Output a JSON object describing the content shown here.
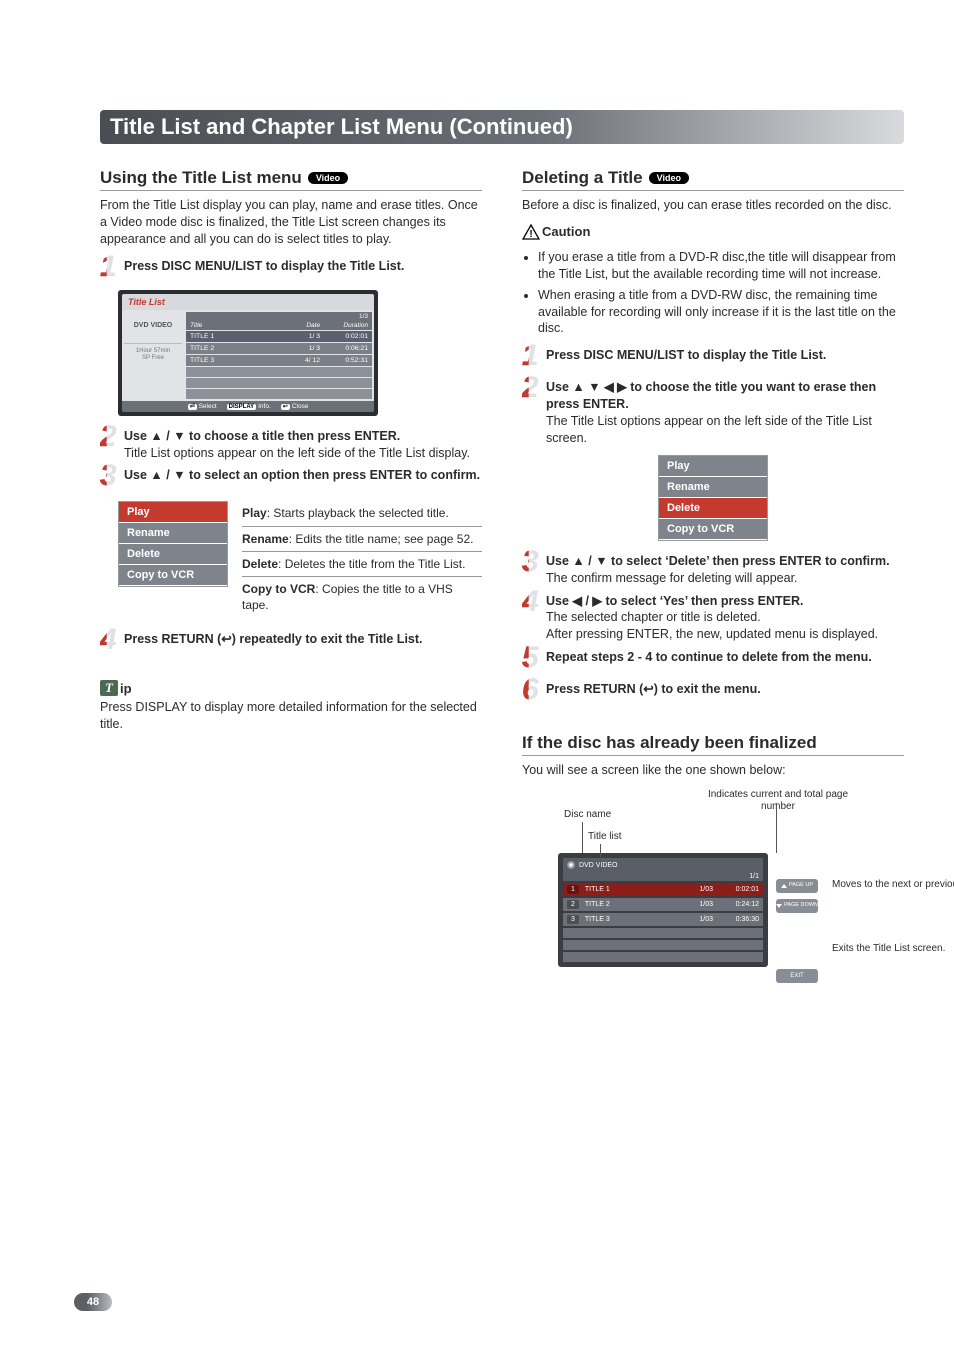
{
  "titlebar": "Title List and Chapter List Menu (Continued)",
  "badge_video": "Video",
  "left": {
    "heading": "Using the Title List menu",
    "intro": "From the Title List display you can play, name and erase titles. Once a Video mode disc is finalized, the Title List screen changes its appearance and all you can do is select titles to play.",
    "step1": "Press DISC MENU/LIST to display the Title List.",
    "step2_a": "Use ▲ / ▼ to choose a title then press ENTER.",
    "step2_b": "Title List options appear on the left side of the Title List display.",
    "step3": "Use ▲ / ▼ to select an option then press ENTER to confirm.",
    "opt_play": "Play",
    "opt_rename": "Rename",
    "opt_delete": "Delete",
    "opt_copy": "Copy to VCR",
    "desc_play": " Starts playback the selected title.",
    "desc_rename": " Edits the title name; see page 52.",
    "desc_delete": " Deletes the title from the Title List.",
    "desc_copy": " Copies the title to a VHS tape.",
    "step4": "Press RETURN (↩) repeatedly to exit the Title List.",
    "tip_label": "ip",
    "tip_text": "Press DISPLAY to display more detailed information for the selected title."
  },
  "title_list": {
    "header": "Title List",
    "page": "1/3",
    "side_label": "DVD VIDEO",
    "side_stat1": "1Hour 57min",
    "side_stat2": "SP Free",
    "col_title": "Title",
    "col_date": "Date",
    "col_duration": "Duration",
    "rows": [
      {
        "t": "TITLE 1",
        "d": "1/ 3",
        "u": "0:02:01"
      },
      {
        "t": "TITLE 2",
        "d": "1/ 3",
        "u": "0:06:21"
      },
      {
        "t": "TITLE 3",
        "d": "4/ 12",
        "u": "0:52:31"
      }
    ],
    "foot_select": "Select",
    "foot_display": "DISPLAY",
    "foot_info": "Info.",
    "foot_close": "Close"
  },
  "right": {
    "heading": "Deleting a Title",
    "intro": "Before a disc is finalized, you can erase titles recorded on the disc.",
    "caution_label": "Caution",
    "caution1": "If you erase a title from a DVD-R disc,the title will disappear from the Title List, but the available recording time will not increase.",
    "caution2": "When erasing a title from a DVD-RW disc, the remaining time available for recording will only increase if it is the last title on the disc.",
    "step1": "Press DISC MENU/LIST to display the Title List.",
    "step2_a": "Use ▲ ▼ ◀ ▶ to choose the title you want to erase then press ENTER.",
    "step2_b": "The Title List options appear on the left side of the Title List screen.",
    "step3_a": "Use ▲ / ▼ to select ‘Delete’ then press ENTER to confirm.",
    "step3_b": "The confirm message for deleting will appear.",
    "step4_a": "Use ◀ / ▶ to select ‘Yes’ then press ENTER.",
    "step4_b": "The selected chapter or title is deleted.",
    "step4_c": "After pressing ENTER, the new, updated menu is displayed.",
    "step5": "Repeat steps 2 - 4 to continue to delete from the menu.",
    "step6": "Press RETURN (↩) to exit the menu.",
    "finalized_heading": "If the disc has already been finalized",
    "finalized_text": "You will see a screen like the one shown below:",
    "annot_page": "Indicates current and total page number",
    "annot_disc": "Disc name",
    "annot_list": "Title list",
    "annot_pagebtn": "Moves to the next or previous page",
    "annot_exit": "Exits the Title List screen."
  },
  "finalized": {
    "header": "DVD VIDEO",
    "page": "1/1",
    "rows": [
      {
        "n": "1",
        "t": "TITLE 1",
        "d": "1/03",
        "u": "0:02:01"
      },
      {
        "n": "2",
        "t": "TITLE 2",
        "d": "1/03",
        "u": "0:24:12"
      },
      {
        "n": "3",
        "t": "TITLE 3",
        "d": "1/03",
        "u": "0:36:30"
      }
    ],
    "btn_up": "PAGE UP",
    "btn_down": "PAGE DOWN",
    "btn_exit": "EXIT"
  },
  "page_number": "48"
}
